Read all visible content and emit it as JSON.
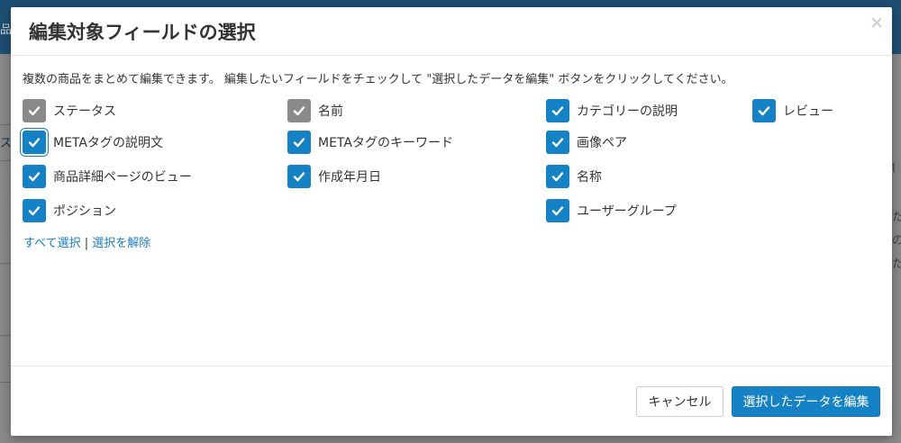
{
  "background": {
    "left_fragments": [
      "品",
      "ス"
    ],
    "right_fragments": [
      "l",
      "た",
      "の",
      "た"
    ]
  },
  "modal": {
    "title": "編集対象フィールドの選択",
    "close_glyph": "×",
    "description": "複数の商品をまとめて編集できます。 編集したいフィールドをチェックして \"選択したデータを編集\" ボタンをクリックしてください。",
    "fields": [
      {
        "label": "ステータス",
        "checked": true,
        "disabled": true
      },
      {
        "label": "名前",
        "checked": true,
        "disabled": true
      },
      {
        "label": "カテゴリーの説明",
        "checked": true,
        "disabled": false
      },
      {
        "label": "レビュー",
        "checked": true,
        "disabled": false
      },
      {
        "label": "METAタグの説明文",
        "checked": true,
        "disabled": false,
        "focused": true
      },
      {
        "label": "METAタグのキーワード",
        "checked": true,
        "disabled": false
      },
      {
        "label": "画像ペア",
        "checked": true,
        "disabled": false
      },
      {
        "label": "商品詳細ページのビュー",
        "checked": true,
        "disabled": false
      },
      {
        "label": "作成年月日",
        "checked": true,
        "disabled": false
      },
      {
        "label": "名称",
        "checked": true,
        "disabled": false
      },
      {
        "label": "ポジション",
        "checked": true,
        "disabled": false
      },
      {
        "label": "ユーザーグループ",
        "checked": true,
        "disabled": false
      }
    ],
    "select_all": "すべて選択",
    "separator": "|",
    "deselect": "選択を解除",
    "cancel_label": "キャンセル",
    "submit_label": "選択したデータを編集"
  },
  "colors": {
    "accent": "#1682c6",
    "disabled_checkbox": "#8a8a8a",
    "link": "#1c7cc1"
  }
}
